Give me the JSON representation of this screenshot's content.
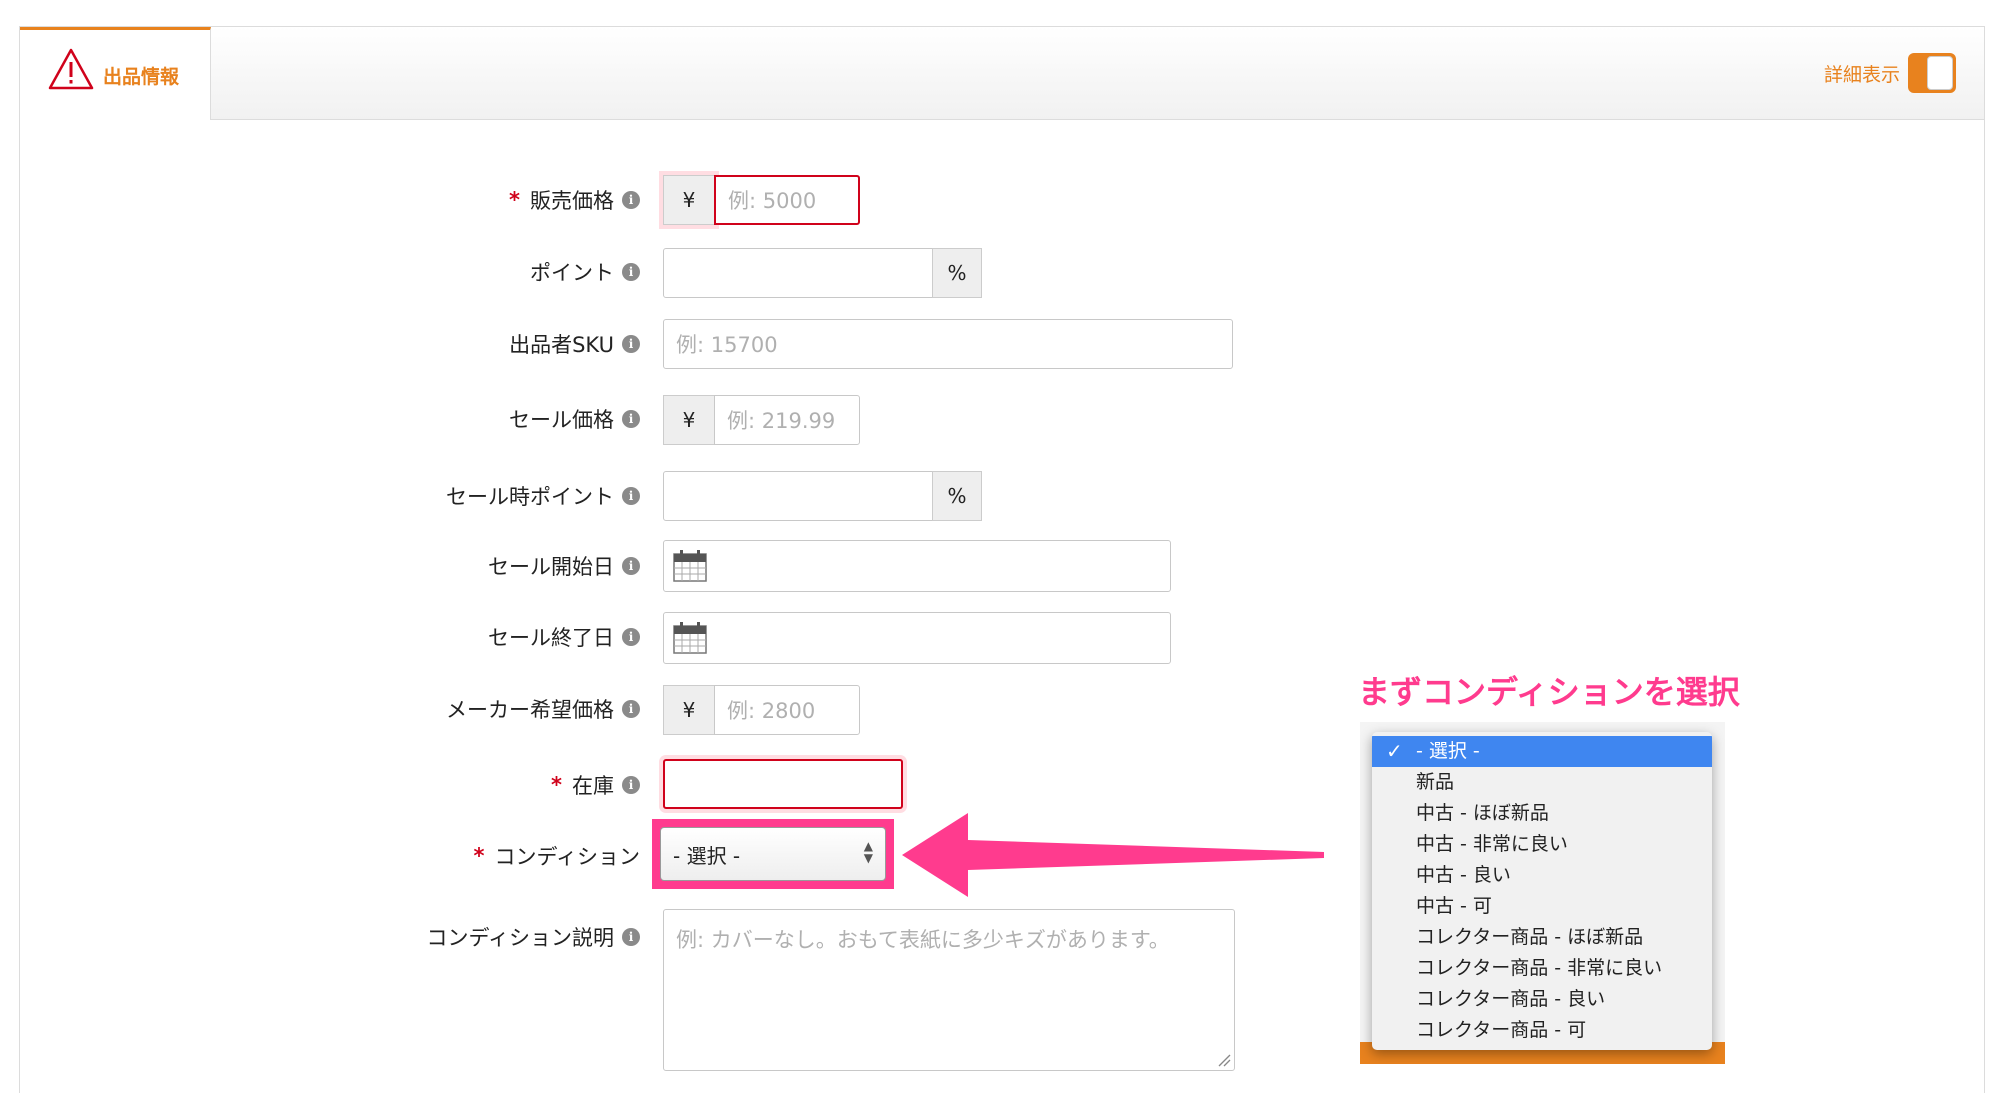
{
  "tab": {
    "label": "出品情報"
  },
  "header": {
    "detail_toggle_label": "詳細表示"
  },
  "colors": {
    "accent": "#e8821e",
    "required": "#d0021b",
    "annotation": "#ff3b8e",
    "selected_option": "#3f86f0"
  },
  "form": {
    "required_mark": "*",
    "info_icon": "i",
    "currency": "¥",
    "percent": "%",
    "price": {
      "label": "販売価格",
      "placeholder": "例: 5000"
    },
    "points": {
      "label": "ポイント"
    },
    "sku": {
      "label": "出品者SKU",
      "placeholder": "例: 15700"
    },
    "sale_price": {
      "label": "セール価格",
      "placeholder": "例: 219.99"
    },
    "sale_points": {
      "label": "セール時ポイント"
    },
    "sale_start": {
      "label": "セール開始日"
    },
    "sale_end": {
      "label": "セール終了日"
    },
    "msrp": {
      "label": "メーカー希望価格",
      "placeholder": "例: 2800"
    },
    "stock": {
      "label": "在庫"
    },
    "condition": {
      "label": "コンディション",
      "value": "- 選択 -"
    },
    "condition_note": {
      "label": "コンディション説明",
      "placeholder": "例: カバーなし。おもて表紙に多少キズがあります。"
    }
  },
  "annotation": {
    "text": "まずコンディションを選択"
  },
  "dropdown": {
    "check": "✓",
    "options": [
      "- 選択 -",
      "新品",
      "中古 - ほぼ新品",
      "中古 - 非常に良い",
      "中古 - 良い",
      "中古 - 可",
      "コレクター商品 - ほぼ新品",
      "コレクター商品 - 非常に良い",
      "コレクター商品 - 良い",
      "コレクター商品 - 可"
    ],
    "selected_index": 0
  }
}
